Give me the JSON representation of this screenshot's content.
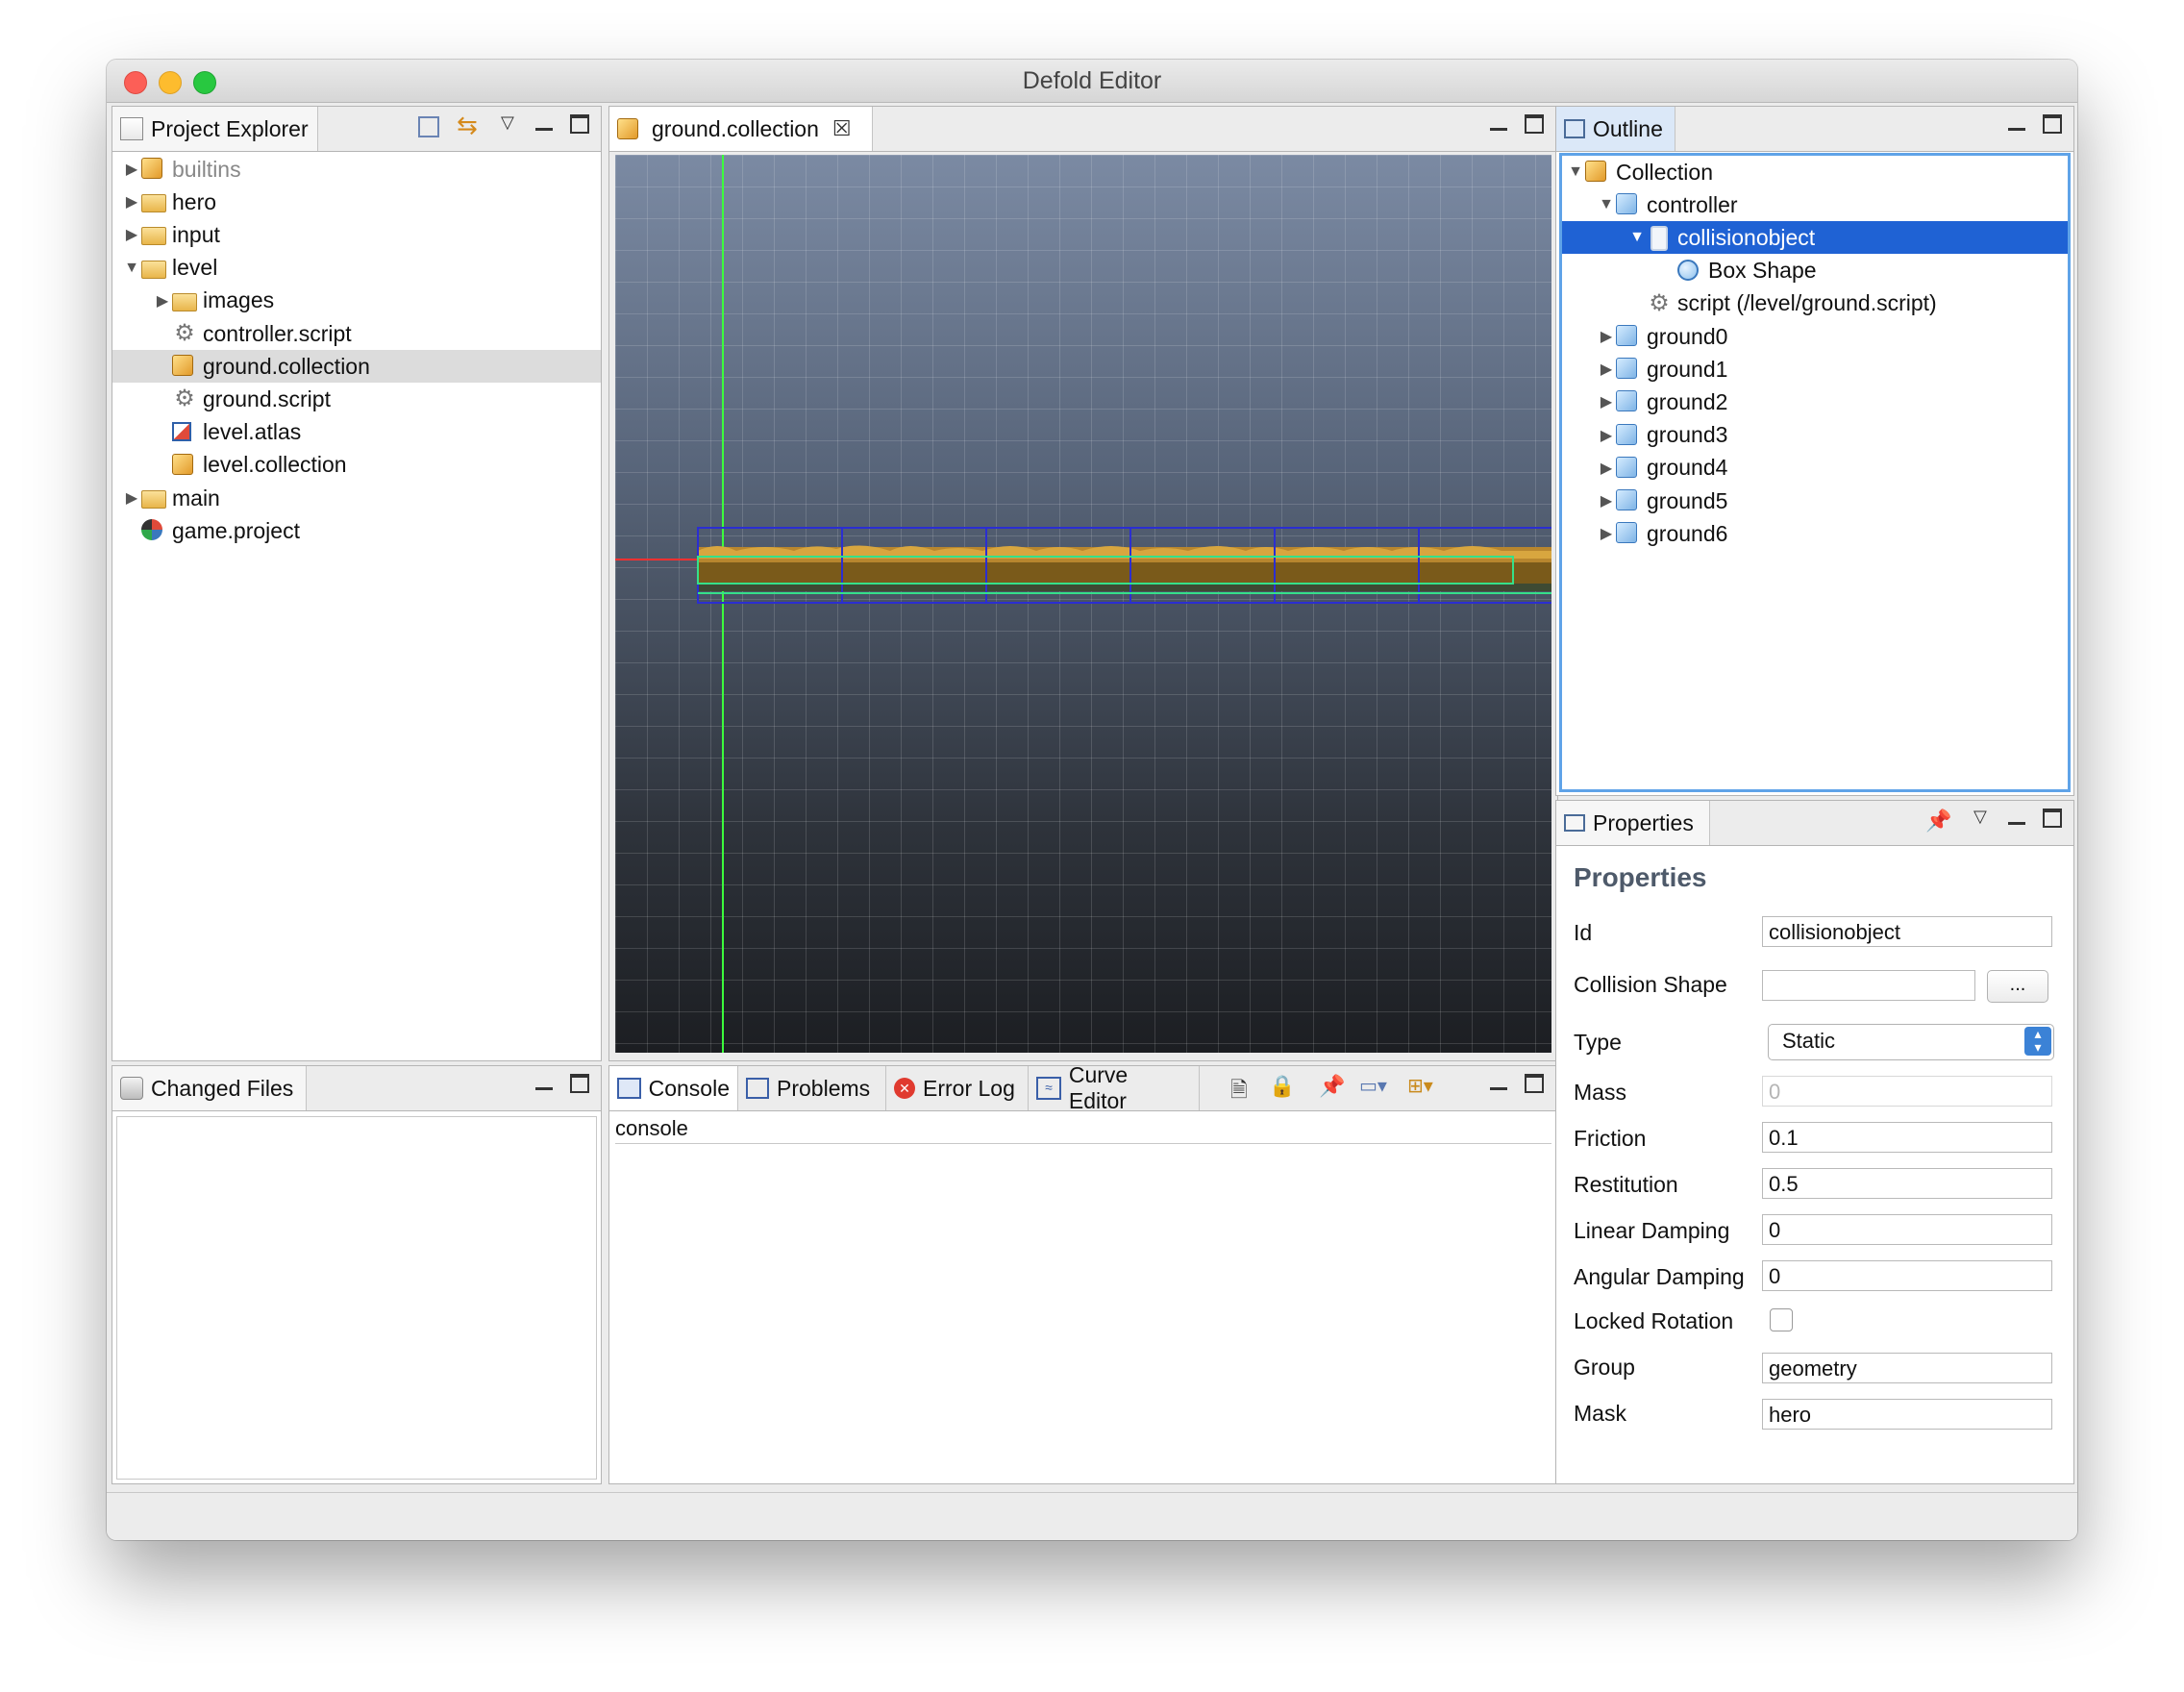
{
  "window": {
    "title": "Defold Editor"
  },
  "project_explorer": {
    "tab_label": "Project Explorer",
    "items": [
      {
        "label": "builtins",
        "icon": "builtins-icon",
        "indent": 0,
        "arrow": "▶",
        "dim": true
      },
      {
        "label": "hero",
        "icon": "folder-icon",
        "indent": 0,
        "arrow": "▶"
      },
      {
        "label": "input",
        "icon": "folder-icon",
        "indent": 0,
        "arrow": "▶"
      },
      {
        "label": "level",
        "icon": "folder-open-icon",
        "indent": 0,
        "arrow": "▼"
      },
      {
        "label": "images",
        "icon": "folder-icon",
        "indent": 1,
        "arrow": "▶"
      },
      {
        "label": "controller.script",
        "icon": "script-gear-icon",
        "indent": 1,
        "arrow": ""
      },
      {
        "label": "ground.collection",
        "icon": "collection-icon",
        "indent": 1,
        "arrow": "",
        "highlighted": true
      },
      {
        "label": "ground.script",
        "icon": "script-gear-icon",
        "indent": 1,
        "arrow": ""
      },
      {
        "label": "level.atlas",
        "icon": "atlas-icon",
        "indent": 1,
        "arrow": ""
      },
      {
        "label": "level.collection",
        "icon": "collection-icon",
        "indent": 1,
        "arrow": ""
      },
      {
        "label": "main",
        "icon": "folder-icon",
        "indent": 0,
        "arrow": "▶"
      },
      {
        "label": "game.project",
        "icon": "game-project-icon",
        "indent": 0,
        "arrow": ""
      }
    ]
  },
  "editor": {
    "tab_label": "ground.collection"
  },
  "changed_files": {
    "tab_label": "Changed Files"
  },
  "console_panel": {
    "tabs": [
      "Console",
      "Problems",
      "Error Log",
      "Curve Editor"
    ],
    "header": "console"
  },
  "outline": {
    "tab_label": "Outline",
    "items": [
      {
        "label": "Collection",
        "icon": "collection-icon",
        "indent": 0,
        "arrow": "▼"
      },
      {
        "label": "controller",
        "icon": "game-object-icon",
        "indent": 1,
        "arrow": "▼"
      },
      {
        "label": "collisionobject",
        "icon": "collision-object-icon",
        "indent": 2,
        "arrow": "▼",
        "selected": true
      },
      {
        "label": "Box Shape",
        "icon": "shape-icon",
        "indent": 3,
        "arrow": ""
      },
      {
        "label": "script (/level/ground.script)",
        "icon": "script-gear-icon",
        "indent": 2,
        "arrow": ""
      },
      {
        "label": "ground0",
        "icon": "game-object-icon",
        "indent": 1,
        "arrow": "▶"
      },
      {
        "label": "ground1",
        "icon": "game-object-icon",
        "indent": 1,
        "arrow": "▶"
      },
      {
        "label": "ground2",
        "icon": "game-object-icon",
        "indent": 1,
        "arrow": "▶"
      },
      {
        "label": "ground3",
        "icon": "game-object-icon",
        "indent": 1,
        "arrow": "▶"
      },
      {
        "label": "ground4",
        "icon": "game-object-icon",
        "indent": 1,
        "arrow": "▶"
      },
      {
        "label": "ground5",
        "icon": "game-object-icon",
        "indent": 1,
        "arrow": "▶"
      },
      {
        "label": "ground6",
        "icon": "game-object-icon",
        "indent": 1,
        "arrow": "▶"
      }
    ]
  },
  "properties": {
    "tab_label": "Properties",
    "heading": "Properties",
    "id_label": "Id",
    "id_value": "collisionobject",
    "collision_shape_label": "Collision Shape",
    "collision_shape_value": "",
    "browse_label": "...",
    "type_label": "Type",
    "type_value": "Static",
    "mass_label": "Mass",
    "mass_value": "0",
    "friction_label": "Friction",
    "friction_value": "0.1",
    "restitution_label": "Restitution",
    "restitution_value": "0.5",
    "linear_damping_label": "Linear Damping",
    "linear_damping_value": "0",
    "angular_damping_label": "Angular Damping",
    "angular_damping_value": "0",
    "locked_rotation_label": "Locked Rotation",
    "locked_rotation_checked": false,
    "group_label": "Group",
    "group_value": "geometry",
    "mask_label": "Mask",
    "mask_value": "hero"
  },
  "colors": {
    "selection": "#1f62d4",
    "accent": "#3b82d6"
  }
}
